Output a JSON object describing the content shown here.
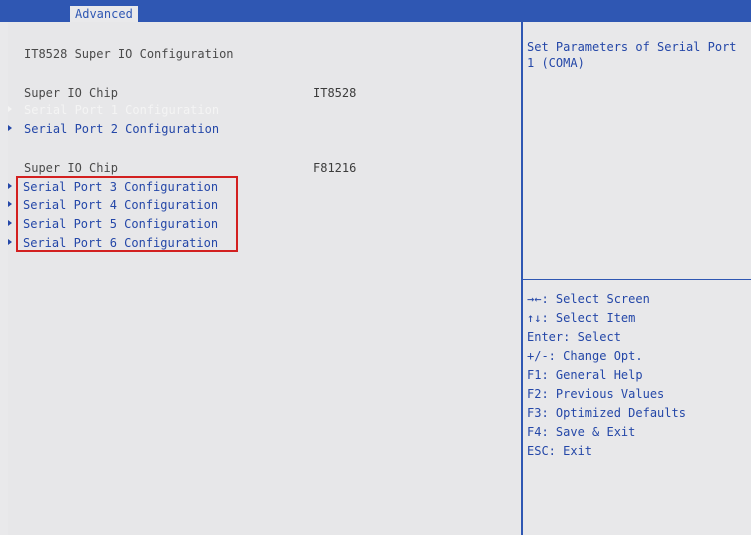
{
  "tabs": {
    "active": "Advanced"
  },
  "header": {
    "section_title": "IT8528 Super IO Configuration"
  },
  "group1": {
    "chip_label": "Super IO Chip",
    "chip_value": "IT8528",
    "items": [
      "Serial Port 1 Configuration",
      "Serial Port 2 Configuration"
    ]
  },
  "group2": {
    "chip_label": "Super IO Chip",
    "chip_value": "F81216",
    "items": [
      "Serial Port 3 Configuration",
      "Serial Port 4 Configuration",
      "Serial Port 5 Configuration",
      "Serial Port 6 Configuration"
    ]
  },
  "help": {
    "description": "Set Parameters of Serial Port\n1 (COMA)",
    "keys": [
      "→←: Select Screen",
      "↑↓: Select Item",
      "Enter: Select",
      "+/-: Change Opt.",
      "F1: General Help",
      "F2: Previous Values",
      "F3: Optimized Defaults",
      "F4: Save & Exit",
      "ESC: Exit"
    ]
  },
  "colors": {
    "header_blue": "#2f57b3",
    "item_blue": "#2447a8",
    "highlight_box": "#d32020",
    "selected_text": "#f4f4f4"
  }
}
